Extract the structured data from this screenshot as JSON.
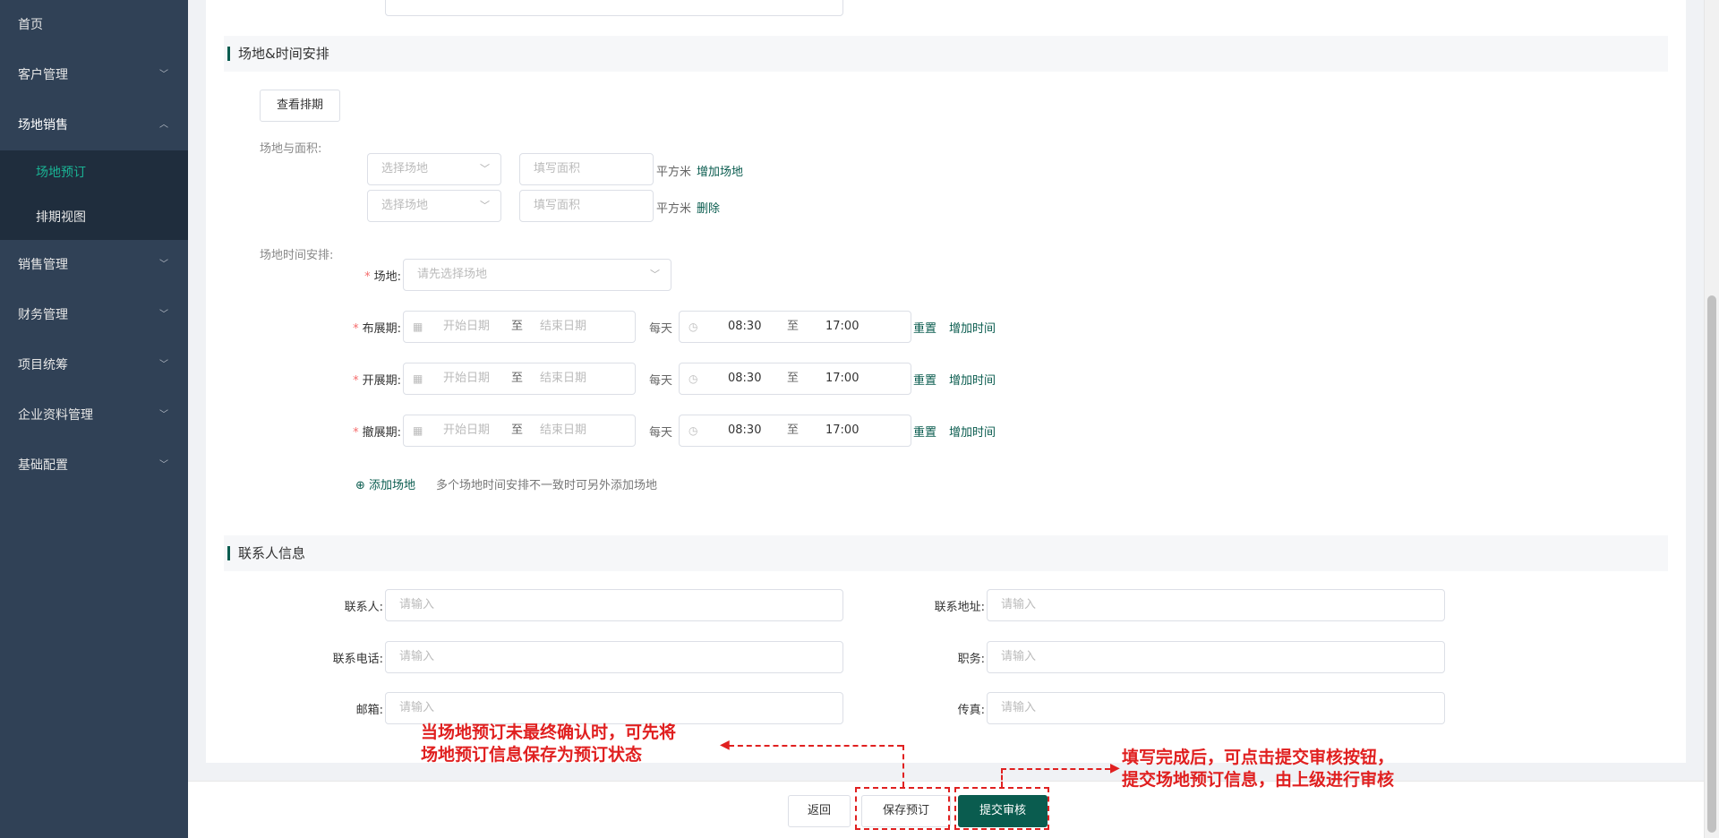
{
  "sidebar": {
    "items": [
      {
        "label": "首页"
      },
      {
        "label": "客户管理"
      },
      {
        "label": "场地销售",
        "children": [
          "场地预订",
          "排期视图"
        ]
      },
      {
        "label": "销售管理"
      },
      {
        "label": "财务管理"
      },
      {
        "label": "项目统筹"
      },
      {
        "label": "企业资料管理"
      },
      {
        "label": "基础配置"
      }
    ]
  },
  "venue_section": {
    "title": "场地&时间安排",
    "view_schedule": "查看排期",
    "area_label": "场地与面积:",
    "select_placeholder": "选择场地",
    "area_placeholder": "填写面积",
    "unit": "平方米",
    "add_venue_link": "增加场地",
    "delete_link": "删除",
    "time_label": "场地时间安排:",
    "venue_field_label": "场地:",
    "venue_field_placeholder": "请先选择场地",
    "start_date": "开始日期",
    "end_date": "结束日期",
    "to": "至",
    "daily": "每天",
    "start_time": "08:30",
    "end_time": "17:00",
    "reset": "重置",
    "add_time": "增加时间",
    "periods": [
      "布展期:",
      "开展期:",
      "撤展期:"
    ],
    "add_venue_btn": "添加场地",
    "add_venue_note": "多个场地时间安排不一致时可另外添加场地"
  },
  "contact_section": {
    "title": "联系人信息",
    "placeholder": "请输入",
    "fields": {
      "contact": "联系人:",
      "address": "联系地址:",
      "phone": "联系电话:",
      "position": "职务:",
      "email": "邮箱:",
      "fax": "传真:"
    }
  },
  "footer": {
    "back": "返回",
    "save": "保存预订",
    "submit": "提交审核"
  },
  "annotations": {
    "left_line1": "当场地预订未最终确认时，可先将",
    "left_line2": "场地预订信息保存为预订状态",
    "right_line1": "填写完成后，可点击提交审核按钮，",
    "right_line2": "提交场地预订信息，由上级进行审核"
  },
  "colors": {
    "sidebar_bg": "#304156",
    "accent": "#0a5c4f",
    "active_menu": "#1ab394",
    "annotation": "#e02020"
  }
}
